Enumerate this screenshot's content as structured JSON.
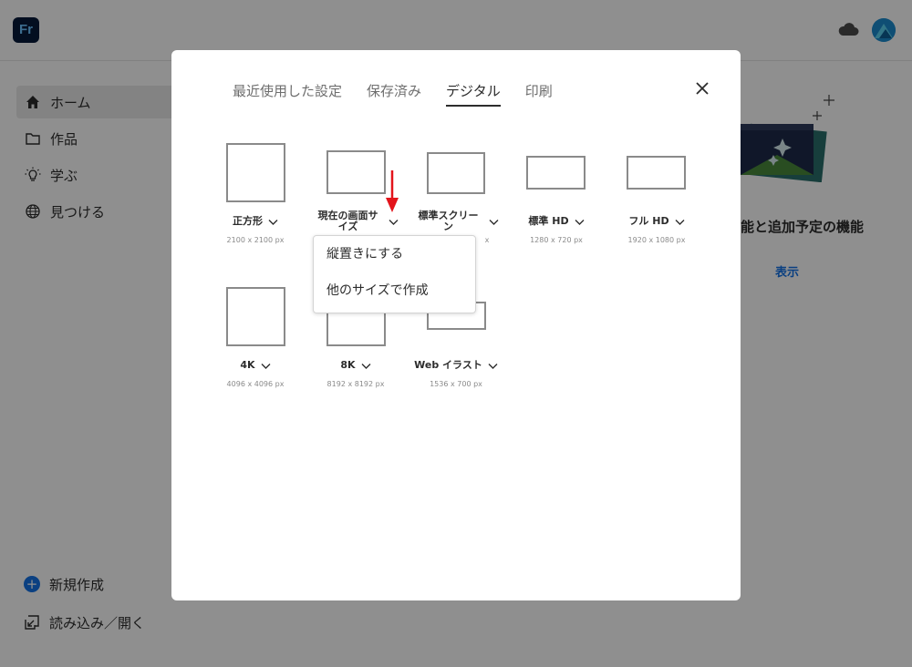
{
  "app": {
    "logo_text": "Fr",
    "nav": [
      {
        "label": "ホーム",
        "icon": "home-icon"
      },
      {
        "label": "作品",
        "icon": "folder-icon"
      },
      {
        "label": "学ぶ",
        "icon": "lightbulb-icon"
      },
      {
        "label": "見つける",
        "icon": "globe-icon"
      }
    ],
    "bottom_nav": [
      {
        "label": "新規作成",
        "icon": "plus-circle-icon"
      },
      {
        "label": "読み込み／開く",
        "icon": "import-icon"
      }
    ],
    "promo": {
      "title": "能と追加予定の機能",
      "link": "表示"
    }
  },
  "dialog": {
    "tabs": [
      {
        "label": "最近使用した設定",
        "active": false
      },
      {
        "label": "保存済み",
        "active": false
      },
      {
        "label": "デジタル",
        "active": true
      },
      {
        "label": "印刷",
        "active": false
      }
    ],
    "presets": [
      {
        "name": "正方形",
        "dims": "2100 x 2100 px"
      },
      {
        "name": "現在の画面サイズ",
        "dims": ""
      },
      {
        "name": "標準スクリーン",
        "dims": "x"
      },
      {
        "name": "標準 HD",
        "dims": "1280 x 720 px"
      },
      {
        "name": "フル HD",
        "dims": "1920 x 1080 px"
      },
      {
        "name": "4K",
        "dims": "4096 x 4096 px"
      },
      {
        "name": "8K",
        "dims": "8192 x 8192 px"
      },
      {
        "name": "Web イラスト",
        "dims": "1536 x 700 px"
      }
    ],
    "dropdown": {
      "items": [
        "縦置きにする",
        "他のサイズで作成"
      ]
    }
  },
  "colors": {
    "accent": "#1473e6",
    "annotation_arrow": "#e3141b",
    "logo_bg": "#071a3a"
  }
}
